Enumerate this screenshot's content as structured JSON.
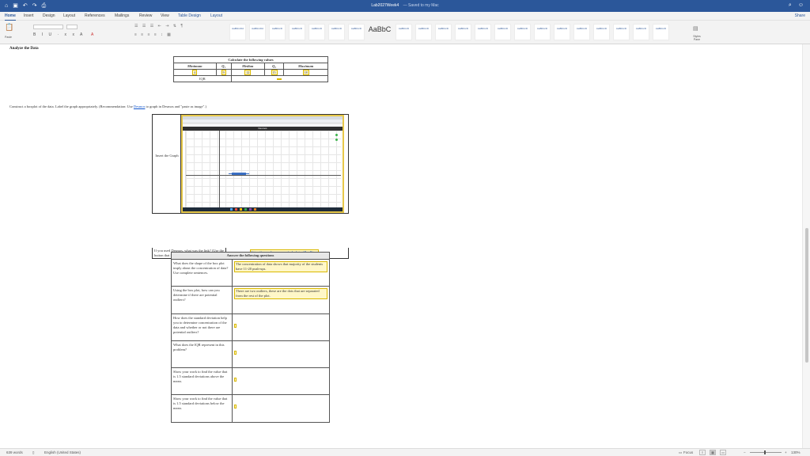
{
  "window": {
    "doc_title": "Lab2027Week4",
    "saved_status": "— Saved to my Mac"
  },
  "qat": {
    "home_icon": "home-icon",
    "save_icon": "save-icon",
    "undo_icon": "undo-icon",
    "redo_icon": "redo-icon",
    "print_icon": "print-icon"
  },
  "tabs": [
    "Home",
    "Insert",
    "Design",
    "Layout",
    "References",
    "Mailings",
    "Review",
    "View",
    "Table Design",
    "Layout"
  ],
  "share_label": "Share",
  "ribbon": {
    "paste_label": "Paste",
    "styles_preview_big": "AaBbC",
    "styles_pane_label": "Styles Pane"
  },
  "document": {
    "analyze_heading": "Analyze the Data",
    "stats": {
      "caption": "Calculate the following values",
      "headers": [
        "Minimum",
        "Q₁",
        "Median",
        "Q₃",
        "Maximum"
      ],
      "values": [
        "4",
        "9",
        "12",
        "15",
        "18"
      ],
      "iqr_label": "IQR",
      "iqr_value": ""
    },
    "instruction_before": "Construct a boxplot of the data. Label the graph appropriately. (Recommendation: Use ",
    "instruction_link": "Desmos",
    "instruction_after": " to graph in Desmos and \"paste as image\".)",
    "graph": {
      "left_label": "Insert the Graph",
      "desmos_title": "Desmos",
      "footer_text": "If you used Desmos, what was the link? (Use the button that looks like this)",
      "link": "https://www.desmos.com/calculator/4bm8tjpu"
    },
    "questions": {
      "header": "Answer the following questions",
      "rows": [
        {
          "q": "What does the shape of the box plot imply about the concentration of data? Use complete sentences.",
          "a": "The concentration of data shows that majority of the students have 11-20 push-ups."
        },
        {
          "q": "Using the box plot, how can you determine if there are potential outliers?",
          "a": "There are two outliers, these are the dots that are separated from the rest of the plot."
        },
        {
          "q": "How does the standard deviation help you to determine concentration of the data and whether or not there are potential outliers?",
          "a": ""
        },
        {
          "q": "What does the IQR represent in this problem?",
          "a": ""
        },
        {
          "q": "Show your work to find the value that is 1.5 standard deviations above the mean.",
          "a": ""
        },
        {
          "q": "Show your work to find the value that is 1.5 standard deviations below the mean.",
          "a": ""
        }
      ]
    }
  },
  "status": {
    "words": "639 words",
    "language": "English (United States)",
    "focus": "Focus",
    "zoom": "130%"
  },
  "colors": {
    "titlebar": "#2b579a",
    "highlight": "#fff7c8"
  }
}
